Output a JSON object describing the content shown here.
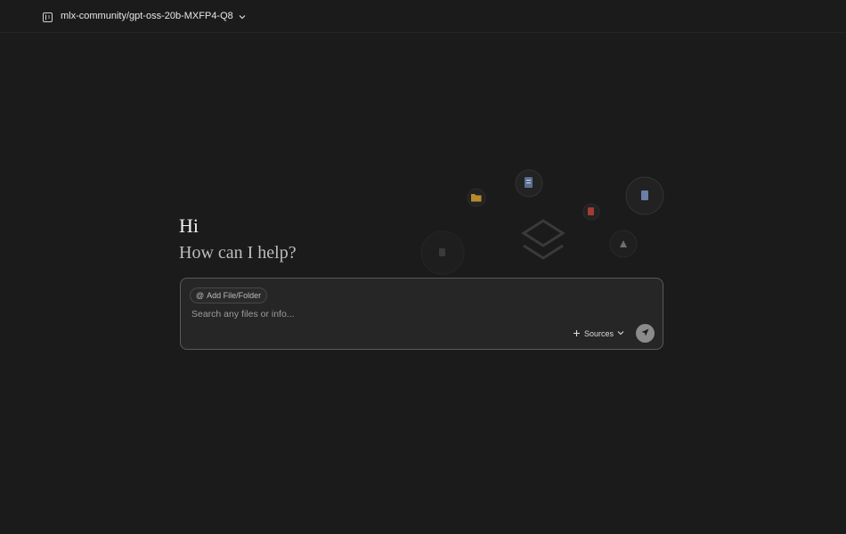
{
  "header": {
    "model_name": "mlx-community/gpt-oss-20b-MXFP4-Q8"
  },
  "greeting": {
    "title": "Hi",
    "subtitle": "How can I help?"
  },
  "composer": {
    "add_chip_label": "Add File/Folder",
    "add_chip_prefix": "@",
    "search_placeholder": "Search any files or info...",
    "sources_label": "Sources"
  },
  "colors": {
    "background": "#1b1b1b",
    "composer_bg": "#262626",
    "composer_border": "#5a5a5a",
    "send_button": "#8b8b8b"
  },
  "icons": {
    "sidebar_toggle": "sidebar-toggle-icon",
    "model_chevron": "chevron-down-icon",
    "sources_plus": "plus-icon",
    "sources_chevron": "chevron-down-icon",
    "send": "send-arrow-icon"
  }
}
